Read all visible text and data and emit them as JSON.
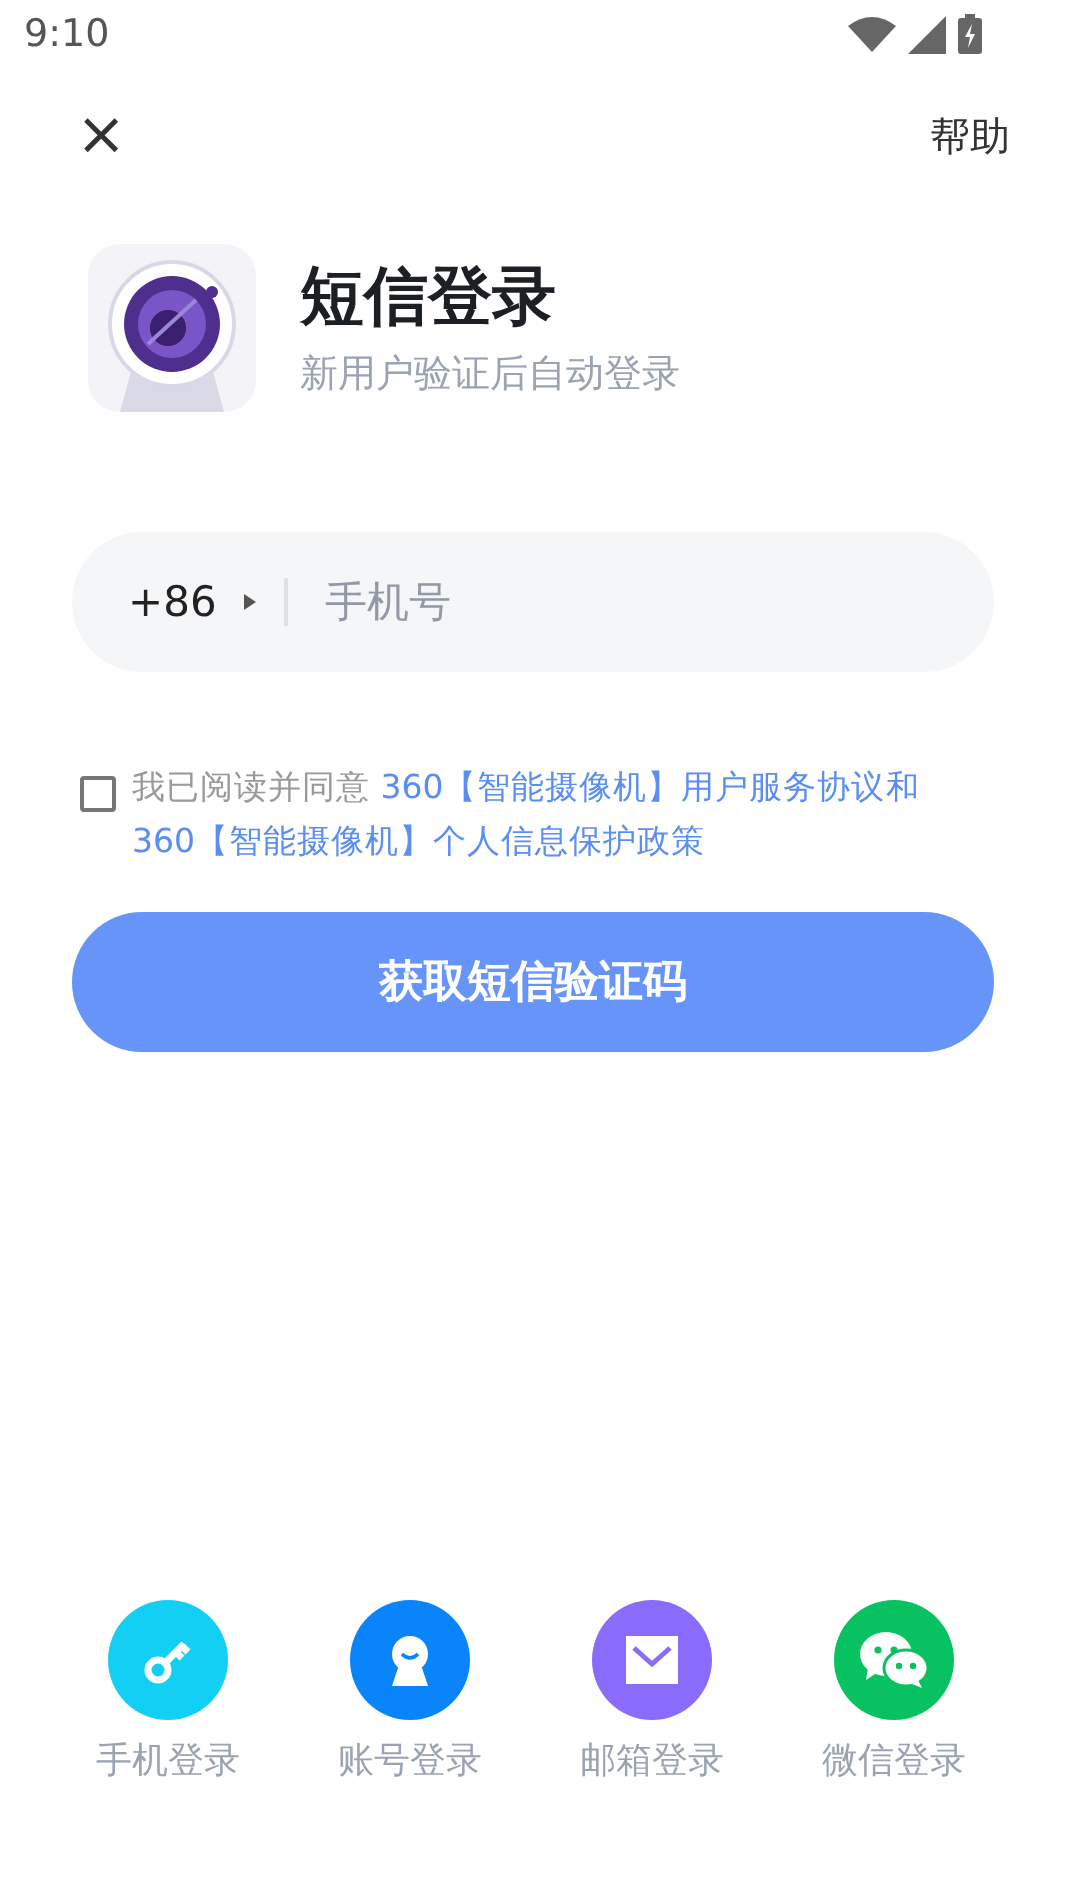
{
  "status_bar": {
    "time": "9:10"
  },
  "header": {
    "close": "×",
    "help": "帮助"
  },
  "intro": {
    "title": "短信登录",
    "subtitle": "新用户验证后自动登录"
  },
  "phone": {
    "country_code": "+86",
    "placeholder": "手机号"
  },
  "agreement": {
    "checked": false,
    "parts": [
      {
        "kind": "text",
        "text": "我已阅读并同意 "
      },
      {
        "kind": "link",
        "text": "360【智能摄像机】用户服务协议"
      },
      {
        "kind": "accent",
        "text": "和"
      },
      {
        "kind": "link",
        "text": "360【智能摄像机】个人信息保护政策"
      }
    ]
  },
  "submit": "获取短信验证码",
  "other_logins": [
    {
      "kind": "phone",
      "label": "手机登录",
      "color": "#13cff4"
    },
    {
      "kind": "account",
      "label": "账号登录",
      "color": "#0a84fb"
    },
    {
      "kind": "email",
      "label": "邮箱登录",
      "color": "#8a6bfb"
    },
    {
      "kind": "wechat",
      "label": "微信登录",
      "color": "#08c161"
    }
  ]
}
